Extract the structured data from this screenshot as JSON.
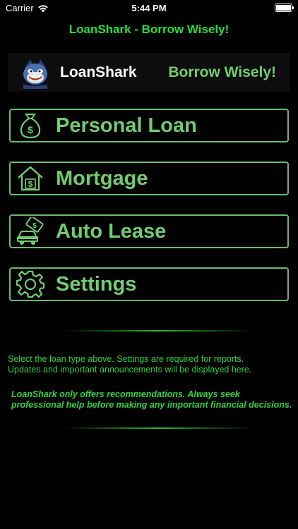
{
  "status_bar": {
    "carrier": "Carrier",
    "time": "5:44 PM",
    "battery_level": 1.0
  },
  "nav": {
    "title": "LoanShark - Borrow Wisely!"
  },
  "banner": {
    "logo_icon": "shark-mascot-icon",
    "app_name": "LoanShark",
    "slogan": "Borrow Wisely!"
  },
  "menu": [
    {
      "id": "personal-loan",
      "label": "Personal Loan",
      "icon": "money-bag-icon"
    },
    {
      "id": "mortgage",
      "label": "Mortgage",
      "icon": "house-dollar-icon"
    },
    {
      "id": "auto-lease",
      "label": "Auto Lease",
      "icon": "car-dollar-icon"
    },
    {
      "id": "settings",
      "label": "Settings",
      "icon": "gear-icon"
    }
  ],
  "info": {
    "line1": "Select the loan type above. Settings are required for reports.",
    "line2": "Updates and important announcements will be displayed here."
  },
  "disclaimer": {
    "text": "LoanShark only offers recommendations. Always seek professional help before making any important financial decisions."
  },
  "colors": {
    "background": "#000000",
    "nav_title": "#22e03a",
    "button_text": "#72cc72",
    "button_border": "#6fb86f",
    "info_text": "#2fd23f"
  }
}
